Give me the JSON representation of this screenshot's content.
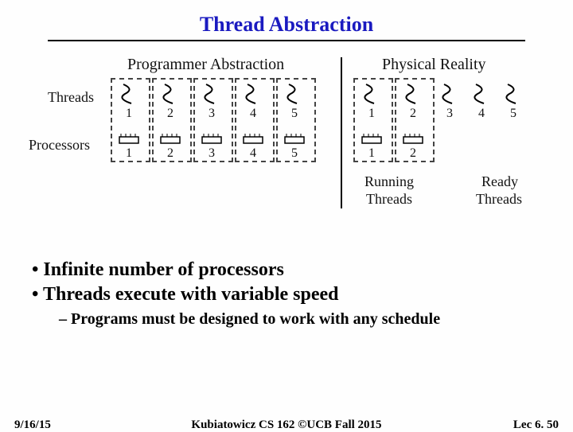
{
  "title": "Thread Abstraction",
  "diagram": {
    "header_left": "Programmer Abstraction",
    "header_right": "Physical Reality",
    "row_threads": "Threads",
    "row_processors": "Processors",
    "left_numbers": [
      "1",
      "2",
      "3",
      "4",
      "5"
    ],
    "right_numbers": [
      "1",
      "2",
      "3",
      "4",
      "5"
    ],
    "right_proc_numbers": [
      "1",
      "2"
    ],
    "running_label_1": "Running",
    "running_label_2": "Threads",
    "ready_label_1": "Ready",
    "ready_label_2": "Threads"
  },
  "bullets": {
    "b1": "Infinite number of processors",
    "b2": "Threads execute with variable speed",
    "sub": "Programs must be designed to work with any schedule"
  },
  "footer": {
    "left": "9/16/15",
    "center": "Kubiatowicz CS 162 ©UCB Fall 2015",
    "right": "Lec 6. 50"
  }
}
